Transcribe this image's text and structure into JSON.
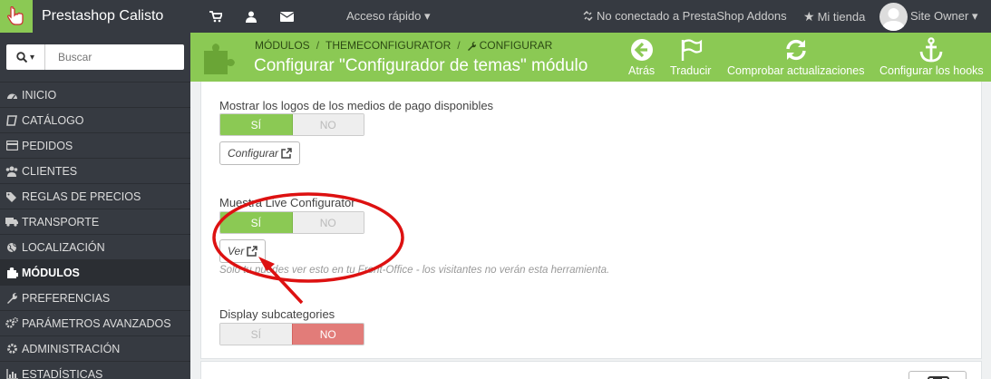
{
  "topbar": {
    "app_title": "Prestashop Calisto",
    "quick_access": "Acceso rápido",
    "addons_status": "No conectado a PrestaShop Addons",
    "my_shop": "Mi tienda",
    "user_name": "Site Owner",
    "icons": [
      "cart-icon",
      "user-icon",
      "envelope-icon"
    ]
  },
  "sidebar": {
    "search_placeholder": "Buscar",
    "items": [
      {
        "label": "INICIO",
        "icon": "dashboard-icon"
      },
      {
        "label": "CATÁLOGO",
        "icon": "book-icon"
      },
      {
        "label": "PEDIDOS",
        "icon": "credit-card-icon"
      },
      {
        "label": "CLIENTES",
        "icon": "users-icon"
      },
      {
        "label": "REGLAS DE PRECIOS",
        "icon": "tags-icon"
      },
      {
        "label": "TRANSPORTE",
        "icon": "truck-icon"
      },
      {
        "label": "LOCALIZACIÓN",
        "icon": "globe-icon"
      },
      {
        "label": "MÓDULOS",
        "icon": "puzzle-icon",
        "active": true
      },
      {
        "label": "PREFERENCIAS",
        "icon": "wrench-icon"
      },
      {
        "label": "PARÁMETROS AVANZADOS",
        "icon": "cogs-icon"
      },
      {
        "label": "ADMINISTRACIÓN",
        "icon": "cog-icon"
      },
      {
        "label": "ESTADÍSTICAS",
        "icon": "bar-chart-icon"
      }
    ]
  },
  "header": {
    "breadcrumb": [
      "MÓDULOS",
      "THEMECONFIGURATOR",
      "CONFIGURAR"
    ],
    "title": "Configurar \"Configurador de temas\" módulo",
    "buttons": {
      "back": "Atrás",
      "translate": "Traducir",
      "check_updates": "Comprobar actualizaciones",
      "configure_hooks": "Configurar los hooks"
    }
  },
  "form": {
    "payment_logos": {
      "label": "Mostrar los logos de los medios de pago disponibles",
      "yes": "SÍ",
      "no": "NO",
      "value": "yes",
      "button": "Configurar"
    },
    "live_configurator": {
      "label": "Muestra Live Configurator",
      "yes": "SÍ",
      "no": "NO",
      "value": "yes",
      "button": "Ver",
      "help": "Solo tu puedes ver esto en tu Front-Office - los visitantes no verán esta herramienta."
    },
    "subcategories": {
      "label": "Display subcategories",
      "yes": "SÍ",
      "no": "NO",
      "value": "no"
    }
  },
  "colors": {
    "accent": "#8bc954",
    "sidebar": "#363a41",
    "danger": "#e27c79",
    "annotation": "#dd1111"
  }
}
